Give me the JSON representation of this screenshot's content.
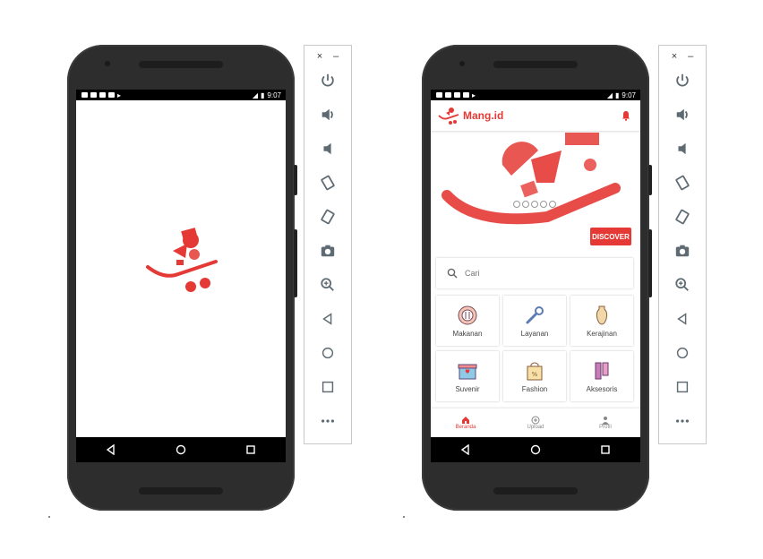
{
  "emulator_left": {
    "status_time": "9:07",
    "splash_logo": "mang-id-logo"
  },
  "emulator_right": {
    "status_time": "9:07",
    "app": {
      "brand": "Mang.id",
      "notification_icon": "bell-icon",
      "discover_label": "DISCOVER",
      "banner_page_count": 5,
      "search_placeholder": "Cari",
      "categories": [
        {
          "label": "Makanan",
          "icon": "plate-icon"
        },
        {
          "label": "Layanan",
          "icon": "wrench-icon"
        },
        {
          "label": "Kerajinan",
          "icon": "vase-icon"
        },
        {
          "label": "Suvenir",
          "icon": "gift-icon"
        },
        {
          "label": "Fashion",
          "icon": "shopping-bag-icon"
        },
        {
          "label": "Aksesoris",
          "icon": "scarf-icon"
        }
      ],
      "bottom_nav": [
        {
          "label": "Beranda",
          "icon": "home-icon",
          "active": true
        },
        {
          "label": "Upload",
          "icon": "plus-circle-icon",
          "active": false
        },
        {
          "label": "Profil",
          "icon": "person-icon",
          "active": false
        }
      ]
    }
  },
  "emulator_toolbar": {
    "close": "×",
    "minimize": "–",
    "tools": [
      "power-icon",
      "volume-up-icon",
      "volume-down-icon",
      "rotate-left-icon",
      "rotate-right-icon",
      "camera-icon",
      "zoom-icon",
      "back-icon",
      "home-circle-icon",
      "overview-icon",
      "more-icon"
    ]
  },
  "colors": {
    "accent": "#e53935",
    "phone_body": "#2d2d2d",
    "toolbar_icon": "#5f6b73"
  }
}
